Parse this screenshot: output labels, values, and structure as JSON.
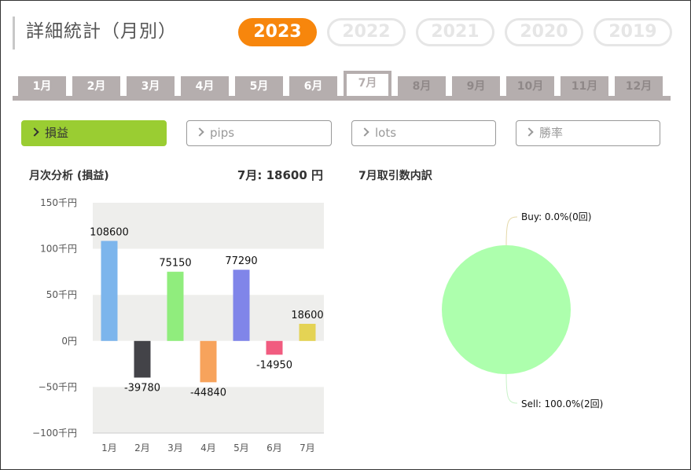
{
  "page": {
    "title": "詳細統計（月別）"
  },
  "years": [
    {
      "label": "2023",
      "active": true
    },
    {
      "label": "2022",
      "active": false
    },
    {
      "label": "2021",
      "active": false
    },
    {
      "label": "2020",
      "active": false
    },
    {
      "label": "2019",
      "active": false
    }
  ],
  "months": [
    {
      "label": "1月",
      "state": "normal"
    },
    {
      "label": "2月",
      "state": "normal"
    },
    {
      "label": "3月",
      "state": "normal"
    },
    {
      "label": "4月",
      "state": "normal"
    },
    {
      "label": "5月",
      "state": "normal"
    },
    {
      "label": "6月",
      "state": "normal"
    },
    {
      "label": "7月",
      "state": "active"
    },
    {
      "label": "8月",
      "state": "future"
    },
    {
      "label": "9月",
      "state": "future"
    },
    {
      "label": "10月",
      "state": "future"
    },
    {
      "label": "11月",
      "state": "future"
    },
    {
      "label": "12月",
      "state": "future"
    }
  ],
  "metrics": [
    {
      "label": "損益",
      "active": true
    },
    {
      "label": "pips",
      "active": false
    },
    {
      "label": "lots",
      "active": false
    },
    {
      "label": "勝率",
      "active": false
    }
  ],
  "monthly": {
    "title": "月次分析 (損益)",
    "summary": "7月:  18600 円"
  },
  "breakdown": {
    "title": "7月取引数内訳"
  },
  "colors": {
    "accent": "#f7860c",
    "metric_active": "#9acd32",
    "tab": "#b5aeae"
  },
  "chart_data": [
    {
      "type": "bar",
      "categories": [
        "1月",
        "2月",
        "3月",
        "4月",
        "5月",
        "6月",
        "7月"
      ],
      "values": [
        108600,
        -39780,
        75150,
        -44840,
        77290,
        -14950,
        18600
      ],
      "value_labels": [
        "108600",
        "-39780",
        "75150",
        "-44840",
        "77290",
        "-14950",
        "18600"
      ],
      "colors": [
        "#7cb5ec",
        "#434348",
        "#90ed7d",
        "#f7a35c",
        "#8085e9",
        "#f15c80",
        "#e4d354"
      ],
      "yticks": [
        150000,
        100000,
        50000,
        0,
        -50000,
        -100000
      ],
      "ytick_labels": [
        "150千円",
        "100千円",
        "50千円",
        "0円",
        "−50千円",
        "−100千円"
      ],
      "ylim": [
        -100000,
        150000
      ],
      "grid": "alternating bands"
    },
    {
      "type": "pie",
      "slices": [
        {
          "label": "Buy: 0.0%(0回)",
          "value": 0,
          "color": "#90ed7d"
        },
        {
          "label": "Sell: 100.0%(2回)",
          "value": 2,
          "color": "#adffad"
        }
      ]
    }
  ]
}
